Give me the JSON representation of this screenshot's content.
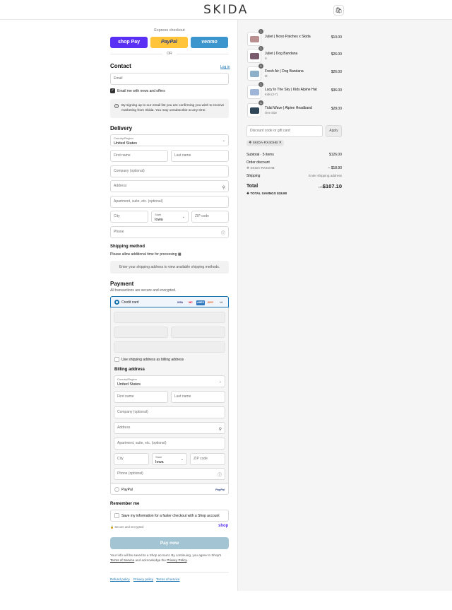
{
  "header": {
    "logo": "SKIDA"
  },
  "express": {
    "label": "Express checkout",
    "shop_pay": "shop Pay",
    "paypal": "PayPal",
    "venmo": "venmo",
    "or": "OR"
  },
  "contact": {
    "title": "Contact",
    "login": "Log in",
    "email_placeholder": "Email",
    "news_label": "Email me with news and offers",
    "notice": "By signing up to our email list you are confirming you wish to receive marketing from Skida. You may unsubscribe at any time."
  },
  "delivery": {
    "title": "Delivery",
    "country_label": "Country/Region",
    "country_value": "United States",
    "first_name": "First name",
    "last_name": "Last name",
    "company": "Company (optional)",
    "address": "Address",
    "apartment": "Apartment, suite, etc. (optional)",
    "city": "City",
    "state_label": "State",
    "state_value": "Iowa",
    "zip": "ZIP code",
    "phone": "Phone"
  },
  "shipping": {
    "title": "Shipping method",
    "note": "Please allow additional time for processing",
    "placeholder": "Enter your shipping address to view available shipping methods."
  },
  "payment": {
    "title": "Payment",
    "subtitle": "All transactions are secure and encrypted.",
    "credit_card": "Credit card",
    "card_logos": [
      "VISA",
      "MC",
      "AMEX",
      "DISC",
      "+4"
    ],
    "use_shipping": "Use shipping address as billing address",
    "billing_title": "Billing address",
    "billing_country_label": "Country/Region",
    "billing_country_value": "United States",
    "billing_first": "First name",
    "billing_last": "Last name",
    "billing_company": "Company (optional)",
    "billing_address": "Address",
    "billing_apartment": "Apartment, suite, etc. (optional)",
    "billing_city": "City",
    "billing_state_label": "State",
    "billing_state_value": "Iowa",
    "billing_zip": "ZIP code",
    "billing_phone": "Phone (optional)",
    "paypal": "PayPal",
    "paypal_logo": "PayPal"
  },
  "remember": {
    "title": "Remember me",
    "save_label": "Save my information for a faster checkout with a Shop account",
    "secure": "Secure and encrypted",
    "shop": "shop"
  },
  "pay_now": "Pay now",
  "legal": {
    "text1": "Your info will be saved to a Shop account. By continuing, you agree to Shop's",
    "terms": "Terms of Service",
    "text2": "and acknowledge the",
    "privacy": "Privacy Policy",
    "text3": "."
  },
  "footer": {
    "refund": "Refund policy",
    "privacy": "Privacy policy",
    "terms": "Terms of service"
  },
  "cart": {
    "items": [
      {
        "name": "Juliet | Noso Patches x Skida",
        "variant": "",
        "price": "$10.00",
        "qty": "1",
        "color": "#b98f8f"
      },
      {
        "name": "Juliet | Dog Bandana",
        "variant": "S",
        "price": "$26.00",
        "qty": "1",
        "color": "#7a5b6e"
      },
      {
        "name": "Fresh Air | Dog Bandana",
        "variant": "M",
        "price": "$26.00",
        "qty": "1",
        "color": "#8fb0c9"
      },
      {
        "name": "Lucy In The Sky | Kids Alpine Hat",
        "variant": "Kids (2-7)",
        "price": "$36.00",
        "qty": "1",
        "color": "#9fb6d8"
      },
      {
        "name": "Tidal Wave | Alpine Headband",
        "variant": "One Size",
        "price": "$28.00",
        "qty": "1",
        "color": "#2f4658"
      }
    ],
    "discount_placeholder": "Discount code or gift card",
    "apply": "Apply",
    "code_tag": "SKIDA-RX4GHB",
    "subtotal_label": "Subtotal · 5 items",
    "subtotal_value": "$126.00",
    "order_discount": "Order discount",
    "discount_code": "SKIDA-RX4GHB",
    "discount_value": "– $18.90",
    "shipping_label": "Shipping",
    "shipping_value": "Enter shipping address",
    "total_label": "Total",
    "currency": "USD",
    "total_value": "$107.10",
    "savings_label": "TOTAL SAVINGS",
    "savings_value": "$18.90"
  }
}
